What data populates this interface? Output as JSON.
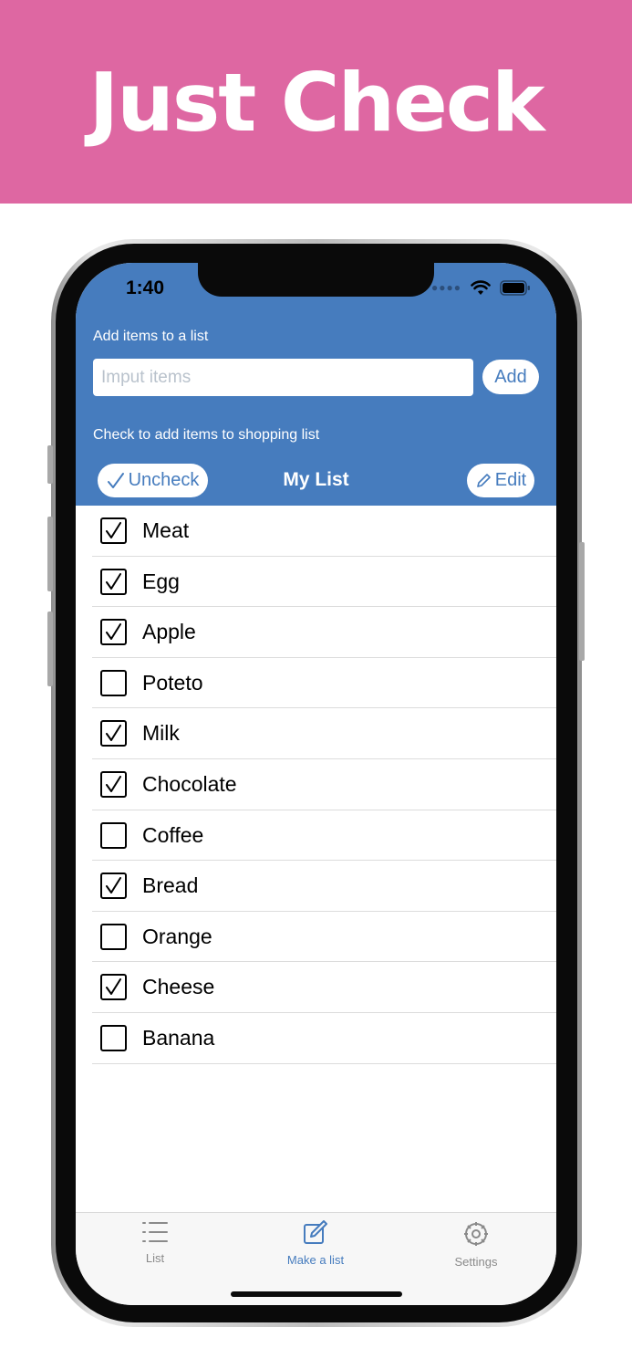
{
  "banner": {
    "title": "Just Check"
  },
  "status_bar": {
    "time": "1:40"
  },
  "form": {
    "add_label": "Add items to a list",
    "input_placeholder": "Imput items",
    "add_button": "Add",
    "check_label": "Check to add items to shopping list"
  },
  "list_header": {
    "uncheck_button": "Uncheck",
    "title": "My List",
    "edit_button": "Edit"
  },
  "items": [
    {
      "label": "Meat",
      "checked": true
    },
    {
      "label": "Egg",
      "checked": true
    },
    {
      "label": "Apple",
      "checked": true
    },
    {
      "label": "Poteto",
      "checked": false
    },
    {
      "label": "Milk",
      "checked": true
    },
    {
      "label": "Chocolate",
      "checked": true
    },
    {
      "label": "Coffee",
      "checked": false
    },
    {
      "label": "Bread",
      "checked": true
    },
    {
      "label": "Orange",
      "checked": false
    },
    {
      "label": "Cheese",
      "checked": true
    },
    {
      "label": "Banana",
      "checked": false
    }
  ],
  "tabs": [
    {
      "label": "List",
      "icon": "list-icon",
      "active": false
    },
    {
      "label": "Make a list",
      "icon": "compose-icon",
      "active": true
    },
    {
      "label": "Settings",
      "icon": "gear-icon",
      "active": false
    }
  ],
  "colors": {
    "banner": "#de67a2",
    "header": "#467cbe",
    "tab_active": "#467cbe",
    "tab_inactive": "#8a8a8a"
  }
}
